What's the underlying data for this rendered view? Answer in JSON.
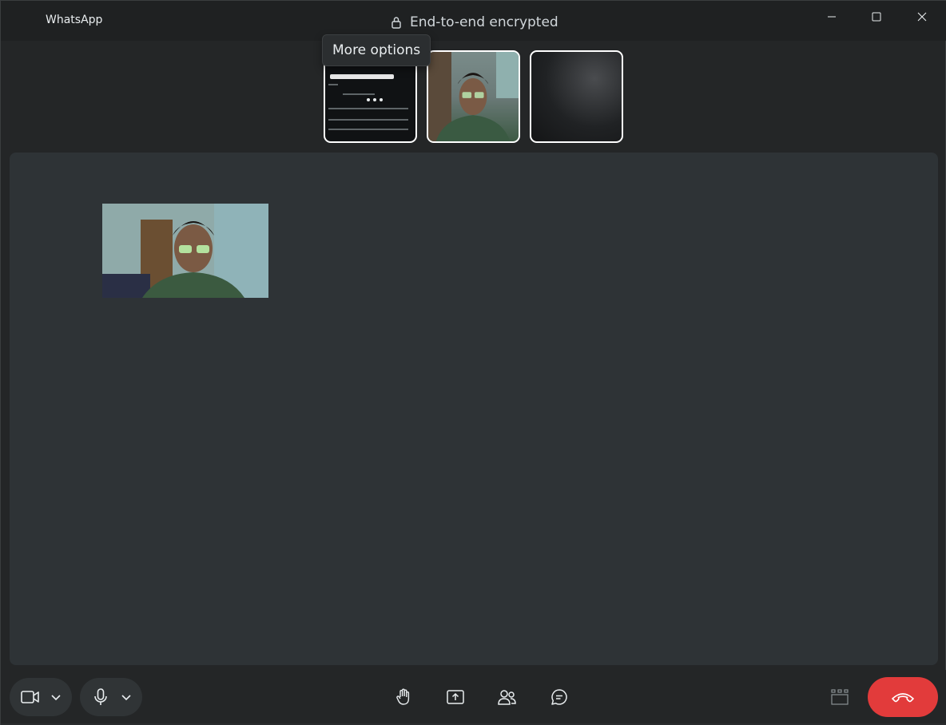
{
  "window": {
    "title": "WhatsApp",
    "encryption_label": "End-to-end encrypted",
    "controls": [
      "minimize-icon",
      "maximize-icon",
      "close-icon"
    ]
  },
  "tooltip": {
    "text": "More options"
  },
  "thumbnails": [
    {
      "kind": "screen-share",
      "icon": "screen-preview"
    },
    {
      "kind": "participant-video",
      "icon": "person"
    },
    {
      "kind": "participant-video-off",
      "icon": "dark"
    }
  ],
  "stage": {
    "self_view": "camera-preview"
  },
  "toolbar": {
    "left": [
      "video-camera-icon",
      "chevron-down-icon",
      "microphone-icon",
      "chevron-down-icon"
    ],
    "center": [
      "raise-hand-icon",
      "share-screen-icon",
      "participants-icon",
      "chat-icon"
    ],
    "right": [
      "layout-icon",
      "end-call-icon"
    ]
  },
  "colors": {
    "background": "#242627",
    "stage": "#2e3336",
    "end_call": "#e23b3b",
    "thumb_border": "#ffffff"
  }
}
